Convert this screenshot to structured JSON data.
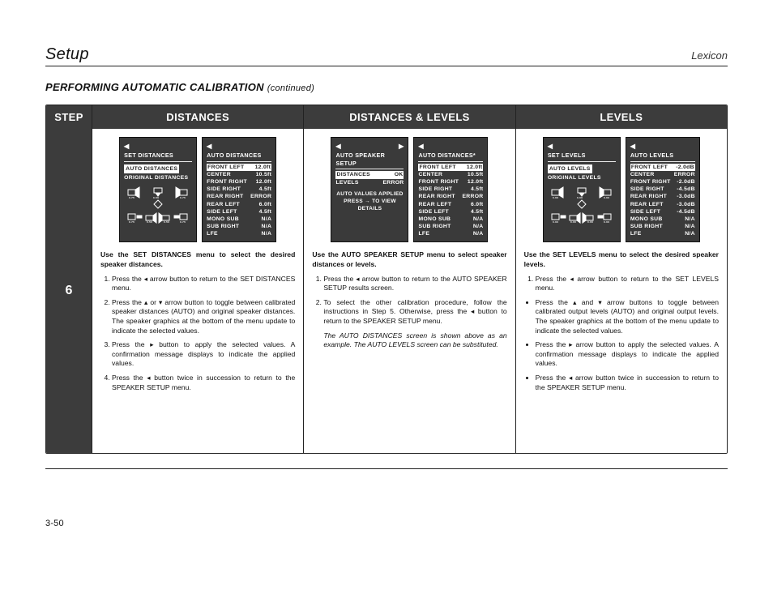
{
  "header": {
    "title": "Setup",
    "brand": "Lexicon"
  },
  "subtitle": {
    "main": "PERFORMING AUTOMATIC CALIBRATION",
    "cont": "(continued)"
  },
  "columns": {
    "step": "STEP",
    "distances": "DISTANCES",
    "dl": "DISTANCES & LEVELS",
    "levels": "LEVELS"
  },
  "stepnum": "6",
  "osd_set_distances": {
    "title": "SET DISTANCES",
    "highlight": "AUTO DISTANCES",
    "line2": "ORIGINAL DISTANCES"
  },
  "osd_auto_distances": {
    "title": "AUTO DISTANCES",
    "rows": [
      [
        "FRONT LEFT",
        "12.0ft"
      ],
      [
        "CENTER",
        "10.5ft"
      ],
      [
        "FRONT RIGHT",
        "12.0ft"
      ],
      [
        "SIDE RIGHT",
        "4.5ft"
      ],
      [
        "REAR RIGHT",
        "ERROR"
      ],
      [
        "REAR LEFT",
        "6.0ft"
      ],
      [
        "SIDE LEFT",
        "4.5ft"
      ],
      [
        "MONO SUB",
        "N/A"
      ],
      [
        "SUB RIGHT",
        "N/A"
      ],
      [
        "LFE",
        "N/A"
      ]
    ],
    "highlight_row": 0
  },
  "osd_auto_setup": {
    "title": "AUTO SPEAKER SETUP",
    "rows": [
      [
        "DISTANCES",
        "OK"
      ],
      [
        "LEVELS",
        "ERROR"
      ]
    ],
    "msg1": "AUTO VALUES APPLIED",
    "msg2": "PRESS → TO  VIEW",
    "msg3": "DETAILS",
    "highlight_row": 0
  },
  "osd_auto_distances_star": {
    "title": "AUTO DISTANCES*",
    "rows": [
      [
        "FRONT LEFT",
        "12.0ft"
      ],
      [
        "CENTER",
        "10.5ft"
      ],
      [
        "FRONT RIGHT",
        "12.0ft"
      ],
      [
        "SIDE RIGHT",
        "4.5ft"
      ],
      [
        "REAR RIGHT",
        "ERROR"
      ],
      [
        "REAR LEFT",
        "6.0ft"
      ],
      [
        "SIDE LEFT",
        "4.5ft"
      ],
      [
        "MONO SUB",
        "N/A"
      ],
      [
        "SUB RIGHT",
        "N/A"
      ],
      [
        "LFE",
        "N/A"
      ]
    ],
    "highlight_row": 0
  },
  "osd_set_levels": {
    "title": "SET LEVELS",
    "highlight": "AUTO LEVELS",
    "line2": "ORIGINAL LEVELS"
  },
  "osd_auto_levels": {
    "title": "AUTO LEVELS",
    "rows": [
      [
        "FRONT LEFT",
        "-2.0dB"
      ],
      [
        "CENTER",
        "ERROR"
      ],
      [
        "FRONT RIGHT",
        "-2.0dB"
      ],
      [
        "SIDE RIGHT",
        "-4.5dB"
      ],
      [
        "REAR RIGHT",
        "-3.0dB"
      ],
      [
        "REAR LEFT",
        "-3.0dB"
      ],
      [
        "SIDE LEFT",
        "-4.5dB"
      ],
      [
        "MONO SUB",
        "N/A"
      ],
      [
        "SUB RIGHT",
        "N/A"
      ],
      [
        "LFE",
        "N/A"
      ]
    ],
    "highlight_row": 0
  },
  "text_dist": {
    "intro": "Use the SET DISTANCES menu to select the desired speaker distances.",
    "items": [
      "Press the ◂ arrow button to return to the SET DISTANCES menu.",
      "Press the ▴ or ▾ arrow button to toggle between calibrated speaker distances (AUTO) and original speaker distances. The speaker graphics at the bottom of the menu update to indicate the selected values.",
      "Press the ▸ button to apply the selected values. A confirmation message displays to indicate the applied values.",
      "Press the ◂ button twice in succession to return to the SPEAKER SETUP menu."
    ]
  },
  "text_dl": {
    "intro": "Use the AUTO SPEAKER SETUP menu to select speaker distances or levels.",
    "items": [
      "Press the ◂ arrow button to return to the AUTO SPEAKER SETUP results screen.",
      "To select the other calibration procedure, follow the instructions in Step 5. Otherwise, press the ◂ button to return to the SPEAKER SETUP menu."
    ],
    "note": "The AUTO DISTANCES screen is shown above as an example. The AUTO LEVELS screen can be substituted."
  },
  "text_lev": {
    "intro": "Use the SET LEVELS menu to select the desired speaker levels.",
    "items": [
      "Press the ◂ arrow button to return to the SET LEVELS menu.",
      "Press the ▴ and ▾ arrow buttons to toggle between calibrated output levels (AUTO) and original output levels. The speaker graphics at the bottom of the menu update to indicate the selected values.",
      "Press the ▸ arrow button to apply the selected values. A confirmation message displays to indicate the applied values.",
      "Press the ◂ arrow button twice in succession to return to the SPEAKER SETUP menu."
    ]
  },
  "pagenum": "3-50"
}
